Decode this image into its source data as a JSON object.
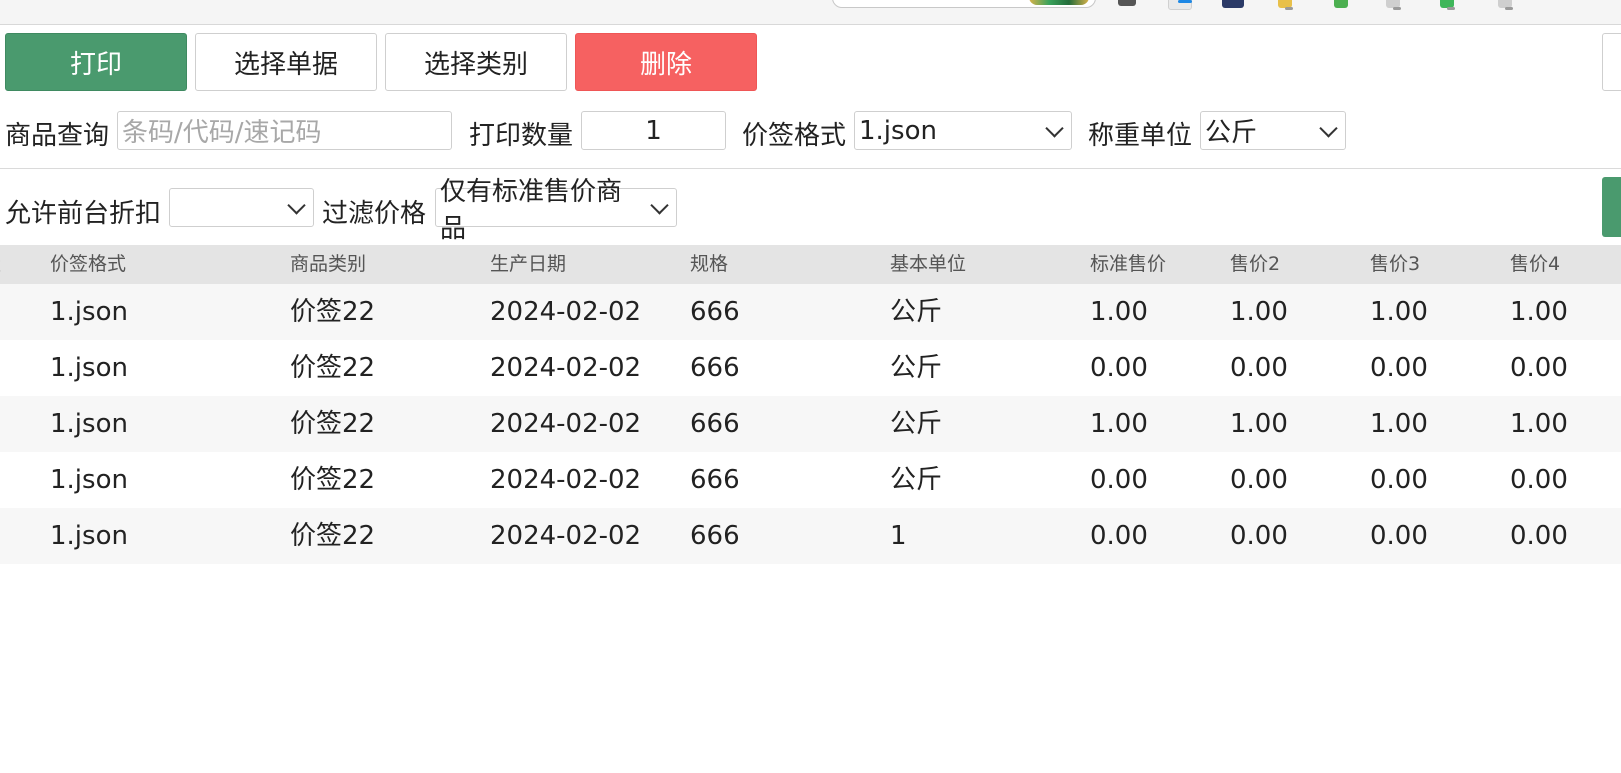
{
  "toolbar": {
    "print_label": "打印",
    "select_doc_label": "选择单据",
    "select_category_label": "选择类别",
    "delete_label": "删除"
  },
  "colors": {
    "print_button": "#4a9a6e",
    "delete_button": "#f66161",
    "header_bg": "#e4e4e4",
    "row_alt_bg": "#f7f7f7"
  },
  "filters": {
    "product_query_label": "商品查询",
    "product_query_placeholder": "条码/代码/速记码",
    "print_qty_label": "打印数量",
    "print_qty_value": "1",
    "tag_format_label": "价签格式",
    "tag_format_value": "1.json",
    "weigh_unit_label": "称重单位",
    "weigh_unit_value": "公斤",
    "allow_discount_label": "允许前台折扣",
    "allow_discount_value": "",
    "filter_price_label": "过滤价格",
    "filter_price_value": "仅有标准售价商品"
  },
  "table": {
    "columns": [
      "量",
      "价签格式",
      "商品类别",
      "生产日期",
      "规格",
      "基本单位",
      "标准售价",
      "售价2",
      "售价3",
      "售价4"
    ],
    "rows": [
      [
        "1.json",
        "价签22",
        "2024-02-02",
        "666",
        "公斤",
        "1.00",
        "1.00",
        "1.00",
        "1.00"
      ],
      [
        "1.json",
        "价签22",
        "2024-02-02",
        "666",
        "公斤",
        "0.00",
        "0.00",
        "0.00",
        "0.00"
      ],
      [
        "1.json",
        "价签22",
        "2024-02-02",
        "666",
        "公斤",
        "1.00",
        "1.00",
        "1.00",
        "1.00"
      ],
      [
        "1.json",
        "价签22",
        "2024-02-02",
        "666",
        "公斤",
        "0.00",
        "0.00",
        "0.00",
        "0.00"
      ],
      [
        "1.json",
        "价签22",
        "2024-02-02",
        "666",
        "1",
        "0.00",
        "0.00",
        "0.00",
        "0.00"
      ]
    ]
  }
}
